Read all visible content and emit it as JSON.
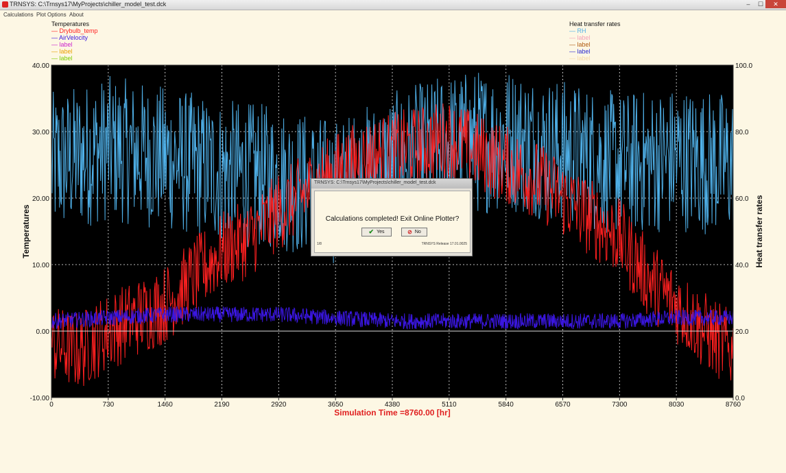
{
  "window": {
    "title": "TRNSYS: C:\\Trnsys17\\MyProjects\\chiller_model_test.dck",
    "minimize": "–",
    "maximize": "☐",
    "close": "✕"
  },
  "menu": {
    "items": [
      "Calculations",
      "Plot Options",
      "About"
    ]
  },
  "legend_left": {
    "title": "Temperatures",
    "items": [
      {
        "label": "Drybulb_temp",
        "color": "#ff2020"
      },
      {
        "label": "AirVelocity",
        "color": "#3a16e0"
      },
      {
        "label": "label",
        "color": "#cc22cc"
      },
      {
        "label": "label",
        "color": "#e8a000"
      },
      {
        "label": "label",
        "color": "#7ccc00"
      }
    ]
  },
  "legend_right": {
    "title": "Heat transfer rates",
    "items": [
      {
        "label": "RH",
        "color": "#4fb0e8"
      },
      {
        "label": "label",
        "color": "#f3a0b8"
      },
      {
        "label": "label",
        "color": "#b05a10"
      },
      {
        "label": "label",
        "color": "#2a2ad0"
      },
      {
        "label": "label",
        "color": "#f7d9a8"
      }
    ]
  },
  "chart_data": {
    "type": "line",
    "xlabel": "Simulation Time =8760.00 [hr]",
    "y_left_label": "Temperatures",
    "y_right_label": "Heat transfer rates",
    "xlim": [
      0,
      8760
    ],
    "ylim_left": [
      -10,
      40
    ],
    "ylim_right": [
      0,
      100
    ],
    "x_ticks": [
      "0",
      "730",
      "1460",
      "2190",
      "2920",
      "3650",
      "4380",
      "5110",
      "5840",
      "6570",
      "7300",
      "8030",
      "8760"
    ],
    "y_left_ticks": [
      "-10.00",
      "0.00",
      "10.00",
      "20.00",
      "30.00",
      "40.00"
    ],
    "y_right_ticks": [
      "0.0",
      "20.0",
      "40.0",
      "60.0",
      "80.0",
      "100.0"
    ],
    "grid": true,
    "series": [
      {
        "name": "Drybulb_temp",
        "axis": "left",
        "color": "#ff2020",
        "x": [
          0,
          365,
          730,
          1095,
          1460,
          1825,
          2190,
          2555,
          2920,
          3285,
          3650,
          4015,
          4380,
          4745,
          5110,
          5475,
          5840,
          6205,
          6570,
          6935,
          7300,
          7665,
          8030,
          8395,
          8760
        ],
        "values": [
          -2,
          -3,
          0,
          2,
          4,
          8,
          12,
          14,
          18,
          21,
          24,
          26,
          27,
          28,
          29,
          27,
          25,
          23,
          20,
          17,
          14,
          8,
          4,
          0,
          -3
        ]
      },
      {
        "name": "AirVelocity",
        "axis": "left",
        "color": "#3a16e0",
        "x": [
          0,
          730,
          1460,
          2190,
          2920,
          3650,
          4380,
          5110,
          5840,
          6570,
          7300,
          8030,
          8760
        ],
        "values": [
          1.5,
          2,
          2.5,
          2.5,
          2.5,
          2,
          1.5,
          1.5,
          1.5,
          1.5,
          1.5,
          2,
          2
        ]
      },
      {
        "name": "RH",
        "axis": "right",
        "color": "#4fb0e8",
        "x": [
          0,
          730,
          1460,
          2190,
          2920,
          3650,
          4380,
          5110,
          5840,
          6570,
          7300,
          8030,
          8760
        ],
        "values": [
          70,
          75,
          72,
          68,
          66,
          62,
          70,
          76,
          78,
          74,
          70,
          72,
          70
        ]
      }
    ]
  },
  "dialog": {
    "title": "TRNSYS: C:\\Trnsys17\\MyProjects\\chiller_model_test.dck",
    "message": "Calculations completed!  Exit Online Plotter?",
    "yes": "Yes",
    "no": "No",
    "footer_left": "1/8",
    "footer_right": "TRNSYS Release 17.01.0025"
  }
}
